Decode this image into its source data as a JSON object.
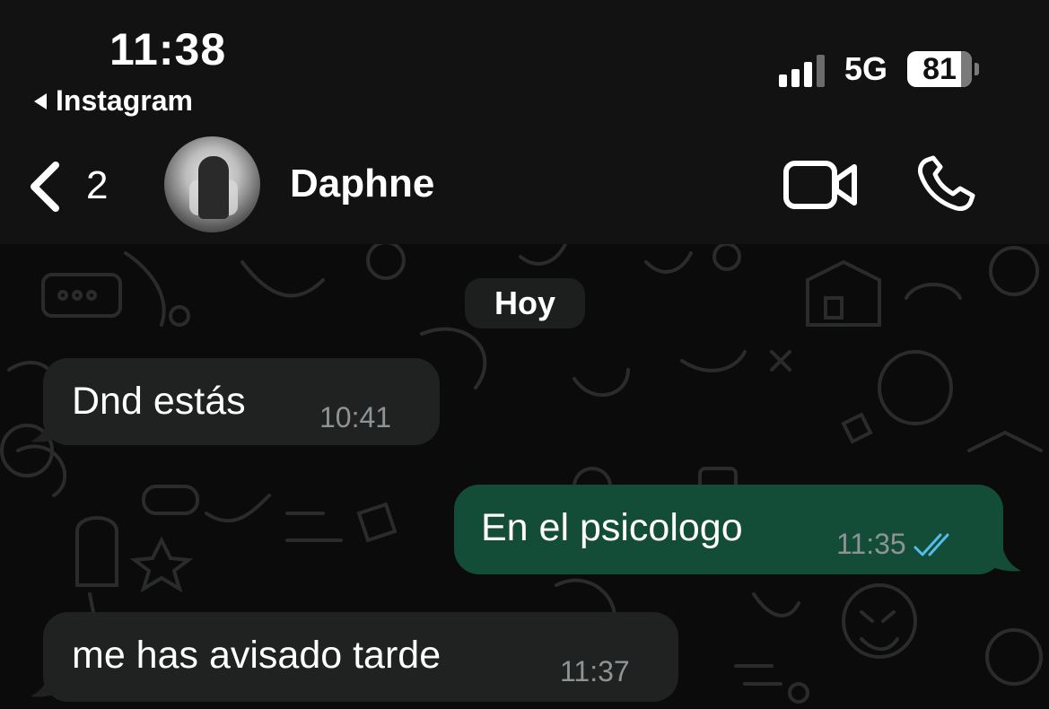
{
  "status_bar": {
    "time": "11:38",
    "back_to_app": "Instagram",
    "network": "5G",
    "battery": "81",
    "signal_bars_active": 3
  },
  "header": {
    "unread_count": "2",
    "contact_name": "Daphne"
  },
  "chat": {
    "day_label": "Hoy",
    "messages": [
      {
        "direction": "incoming",
        "text": "Dnd estás",
        "time": "10:41"
      },
      {
        "direction": "outgoing",
        "text": "En el psicologo",
        "time": "11:35",
        "status": "read"
      },
      {
        "direction": "incoming",
        "text": "me has avisado tarde",
        "time": "11:37"
      }
    ]
  },
  "colors": {
    "background": "#0b0b0b",
    "incoming_bubble": "#202121",
    "outgoing_bubble": "#144d37",
    "read_ticks": "#53bdeb",
    "timestamp": "#8e9395"
  },
  "icons": [
    "back-triangle-icon",
    "signal-icon",
    "battery-icon",
    "chevron-left-icon",
    "video-call-icon",
    "phone-call-icon",
    "read-receipt-icon"
  ]
}
